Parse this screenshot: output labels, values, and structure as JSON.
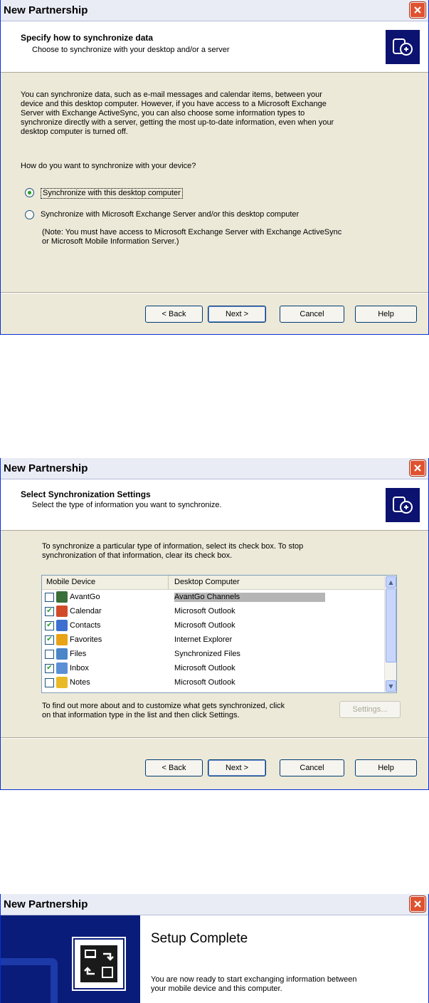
{
  "icons": {
    "close": "close-icon",
    "wizard": "devices-sync-icon",
    "device_computer": "device-to-computer-icon"
  },
  "dialog1": {
    "window_title": "New Partnership",
    "header_title": "Specify how to synchronize data",
    "header_subtitle": "Choose to synchronize with your desktop and/or a server",
    "intro_lines": [
      "You can synchronize data, such as e-mail messages and calendar items, between your",
      "device and this desktop computer.  However, if you have access to a Microsoft Exchange",
      "Server with Exchange ActiveSync, you can also choose some information types to",
      "synchronize directly with a server, getting the most up-to-date information, even when your",
      "desktop computer is turned off."
    ],
    "question": "How do you want to synchronize with your device?",
    "option1": "Synchronize with this desktop computer",
    "option2": "Synchronize with Microsoft Exchange Server and/or this desktop computer",
    "note_lines": [
      "(Note: You must have access to Microsoft Exchange Server with Exchange ActiveSync",
      "or Microsoft Mobile Information Server.)"
    ],
    "selected_option": 1,
    "buttons": {
      "back": "< Back",
      "next": "Next >",
      "cancel": "Cancel",
      "help": "Help"
    }
  },
  "dialog2": {
    "window_title": "New Partnership",
    "header_title": "Select Synchronization Settings",
    "header_subtitle": "Select the type of information you want to synchronize.",
    "intro_lines": [
      "To synchronize a particular type of information, select its check box. To stop",
      "synchronization of that information, clear its check box."
    ],
    "columns": [
      "Mobile Device",
      "Desktop Computer"
    ],
    "rows": [
      {
        "device": "AvantGo",
        "desktop": "AvantGo Channels",
        "checked": false,
        "selected": true,
        "icon": "avantgo-icon",
        "color": "#3a6f3a"
      },
      {
        "device": "Calendar",
        "desktop": "Microsoft Outlook",
        "checked": true,
        "selected": false,
        "icon": "calendar-icon",
        "color": "#d14b2a"
      },
      {
        "device": "Contacts",
        "desktop": "Microsoft Outlook",
        "checked": true,
        "selected": false,
        "icon": "contacts-icon",
        "color": "#3d6fd0"
      },
      {
        "device": "Favorites",
        "desktop": "Internet Explorer",
        "checked": true,
        "selected": false,
        "icon": "favorites-icon",
        "color": "#e8a317"
      },
      {
        "device": "Files",
        "desktop": "Synchronized Files",
        "checked": false,
        "selected": false,
        "icon": "files-icon",
        "color": "#4a86c8"
      },
      {
        "device": "Inbox",
        "desktop": "Microsoft Outlook",
        "checked": true,
        "selected": false,
        "icon": "inbox-icon",
        "color": "#5b8fd6"
      },
      {
        "device": "Notes",
        "desktop": "Microsoft Outlook",
        "checked": false,
        "selected": false,
        "icon": "notes-icon",
        "color": "#e9b928"
      }
    ],
    "footer_lines": [
      "To find out more about and to customize what gets synchronized, click",
      "on that information type in the list and then click Settings."
    ],
    "settings_button": "Settings...",
    "buttons": {
      "back": "< Back",
      "next": "Next >",
      "cancel": "Cancel",
      "help": "Help"
    }
  },
  "dialog3": {
    "window_title": "New Partnership",
    "heading": "Setup Complete",
    "body_lines": [
      "You are now ready to start exchanging information between",
      "your mobile device and this computer."
    ]
  }
}
